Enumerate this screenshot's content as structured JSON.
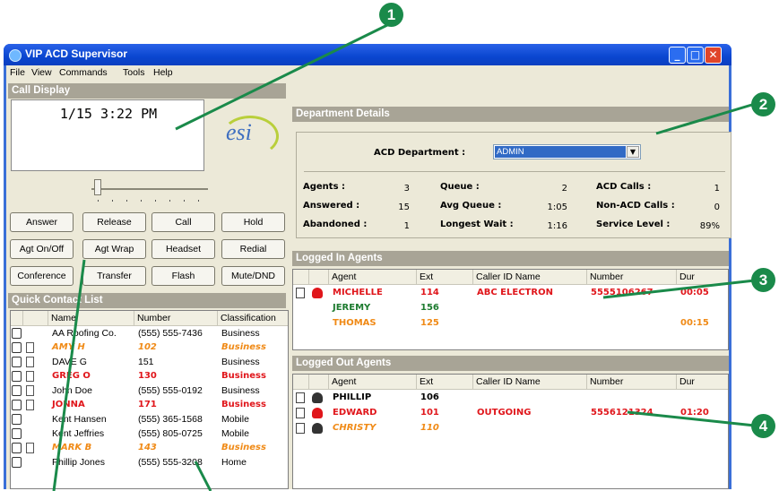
{
  "window": {
    "title": "VIP ACD Supervisor",
    "minimize": "_",
    "maximize": "□",
    "close": "✕"
  },
  "menu": [
    "File",
    "View",
    "Commands",
    "Tools",
    "Help"
  ],
  "call_display": {
    "heading": "Call Display",
    "time": "1/15  3:22 PM",
    "logo": "esi"
  },
  "buttons": [
    "Answer",
    "Release",
    "Call",
    "Hold",
    "Agt On/Off",
    "Agt Wrap",
    "Headset",
    "Redial",
    "Conference",
    "Transfer",
    "Flash",
    "Mute/DND"
  ],
  "quick_contacts": {
    "heading": "Quick Contact List",
    "columns": [
      "Name",
      "Number",
      "Classification"
    ],
    "rows": [
      {
        "name": "AA Roofing Co.",
        "number": "(555) 555-7436",
        "class": "Business",
        "style": "black"
      },
      {
        "name": "AMY H",
        "number": "102",
        "class": "Business",
        "style": "orange"
      },
      {
        "name": "DAVE G",
        "number": "151",
        "class": "Business",
        "style": "black"
      },
      {
        "name": "GREG O",
        "number": "130",
        "class": "Business",
        "style": "red"
      },
      {
        "name": "John Doe",
        "number": "(555) 555-0192",
        "class": "Business",
        "style": "black"
      },
      {
        "name": "JONNA",
        "number": "171",
        "class": "Business",
        "style": "red"
      },
      {
        "name": "Kent Hansen",
        "number": "(555) 365-1568",
        "class": "Mobile",
        "style": "black"
      },
      {
        "name": "Kent Jeffries",
        "number": "(555) 805-0725",
        "class": "Mobile",
        "style": "black"
      },
      {
        "name": "MARK B",
        "number": "143",
        "class": "Business",
        "style": "orange"
      },
      {
        "name": "Phillip Jones",
        "number": "(555) 555-3208",
        "class": "Home",
        "style": "black"
      }
    ]
  },
  "department": {
    "heading": "Department Details",
    "acd_label": "ACD Department :",
    "acd_value": "ADMIN",
    "stats": [
      {
        "label": "Agents :",
        "value": "3"
      },
      {
        "label": "Answered :",
        "value": "15"
      },
      {
        "label": "Abandoned :",
        "value": "1"
      },
      {
        "label": "Queue :",
        "value": "2"
      },
      {
        "label": "Avg Queue :",
        "value": "1:05"
      },
      {
        "label": "Longest Wait :",
        "value": "1:16"
      },
      {
        "label": "ACD Calls :",
        "value": "1"
      },
      {
        "label": "Non-ACD Calls :",
        "value": "0"
      },
      {
        "label": "Service Level :",
        "value": "89%"
      }
    ]
  },
  "logged_in": {
    "heading": "Logged In Agents",
    "columns": [
      "Agent",
      "Ext",
      "Caller ID Name",
      "Number",
      "Dur"
    ],
    "rows": [
      {
        "agent": "MICHELLE",
        "ext": "114",
        "caller": "ABC ELECTRON",
        "number": "5555106267",
        "dur": "00:05",
        "style": "red"
      },
      {
        "agent": "JEREMY",
        "ext": "156",
        "caller": "",
        "number": "",
        "dur": "",
        "style": "green"
      },
      {
        "agent": "THOMAS",
        "ext": "125",
        "caller": "",
        "number": "",
        "dur": "00:15",
        "style": "orange"
      }
    ]
  },
  "logged_out": {
    "heading": "Logged Out Agents",
    "columns": [
      "Agent",
      "Ext",
      "Caller ID Name",
      "Number",
      "Dur"
    ],
    "rows": [
      {
        "agent": "PHILLIP",
        "ext": "106",
        "caller": "",
        "number": "",
        "dur": "",
        "style": "black"
      },
      {
        "agent": "EDWARD",
        "ext": "101",
        "caller": "OUTGOING",
        "number": "5556121324",
        "dur": "01:20",
        "style": "red"
      },
      {
        "agent": "CHRISTY",
        "ext": "110",
        "caller": "",
        "number": "",
        "dur": "",
        "style": "orange"
      }
    ]
  },
  "callouts": [
    "1",
    "2",
    "3",
    "4"
  ],
  "colors": {
    "callout": "#1a8a4a",
    "red": "#e0161b",
    "green": "#1d7b2f",
    "orange": "#f08a16",
    "titlebar": "#0a46d0"
  }
}
